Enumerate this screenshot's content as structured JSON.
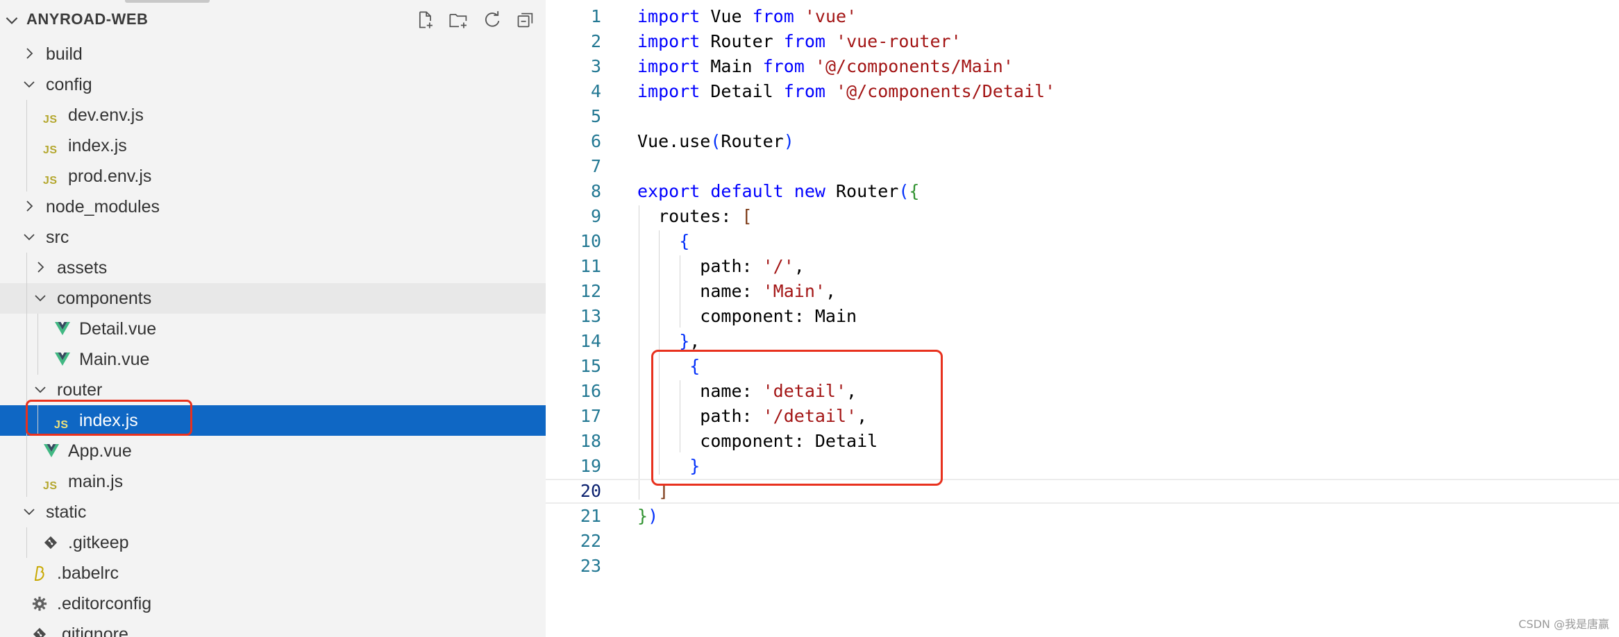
{
  "explorer": {
    "title": "ANYROAD-WEB",
    "actions": [
      {
        "name": "new-file-icon"
      },
      {
        "name": "new-folder-icon"
      },
      {
        "name": "refresh-icon"
      },
      {
        "name": "collapse-all-icon"
      }
    ],
    "items": [
      {
        "label": "build",
        "type": "folder",
        "expanded": false,
        "depth": 0
      },
      {
        "label": "config",
        "type": "folder",
        "expanded": true,
        "depth": 0
      },
      {
        "label": "dev.env.js",
        "type": "js",
        "depth": 1
      },
      {
        "label": "index.js",
        "type": "js",
        "depth": 1
      },
      {
        "label": "prod.env.js",
        "type": "js",
        "depth": 1
      },
      {
        "label": "node_modules",
        "type": "folder",
        "expanded": false,
        "depth": 0
      },
      {
        "label": "src",
        "type": "folder",
        "expanded": true,
        "depth": 0
      },
      {
        "label": "assets",
        "type": "folder",
        "expanded": false,
        "depth": 1
      },
      {
        "label": "components",
        "type": "folder",
        "expanded": true,
        "depth": 1,
        "hover": true
      },
      {
        "label": "Detail.vue",
        "type": "vue",
        "depth": 2
      },
      {
        "label": "Main.vue",
        "type": "vue",
        "depth": 2
      },
      {
        "label": "router",
        "type": "folder",
        "expanded": true,
        "depth": 1
      },
      {
        "label": "index.js",
        "type": "js",
        "depth": 2,
        "selected": true
      },
      {
        "label": "App.vue",
        "type": "vue",
        "depth": 1
      },
      {
        "label": "main.js",
        "type": "js",
        "depth": 1
      },
      {
        "label": "static",
        "type": "folder",
        "expanded": true,
        "depth": 0
      },
      {
        "label": ".gitkeep",
        "type": "git",
        "depth": 1
      },
      {
        "label": ".babelrc",
        "type": "babel",
        "depth": 0
      },
      {
        "label": ".editorconfig",
        "type": "gear",
        "depth": 0
      },
      {
        "label": ".gitignore",
        "type": "git",
        "depth": 0
      }
    ]
  },
  "editor": {
    "current_line": 20,
    "lines": [
      {
        "n": "1",
        "tokens": [
          [
            "kw",
            "import"
          ],
          [
            "t",
            " Vue "
          ],
          [
            "kw",
            "from"
          ],
          [
            "t",
            " "
          ],
          [
            "str",
            "'vue'"
          ]
        ]
      },
      {
        "n": "2",
        "tokens": [
          [
            "kw",
            "import"
          ],
          [
            "t",
            " Router "
          ],
          [
            "kw",
            "from"
          ],
          [
            "t",
            " "
          ],
          [
            "str",
            "'vue-router'"
          ]
        ]
      },
      {
        "n": "3",
        "tokens": [
          [
            "kw",
            "import"
          ],
          [
            "t",
            " Main "
          ],
          [
            "kw",
            "from"
          ],
          [
            "t",
            " "
          ],
          [
            "str",
            "'@/components/Main'"
          ]
        ]
      },
      {
        "n": "4",
        "tokens": [
          [
            "kw",
            "import"
          ],
          [
            "t",
            " Detail "
          ],
          [
            "kw",
            "from"
          ],
          [
            "t",
            " "
          ],
          [
            "str",
            "'@/components/Detail'"
          ]
        ]
      },
      {
        "n": "5",
        "tokens": []
      },
      {
        "n": "6",
        "tokens": [
          [
            "t",
            "Vue.use"
          ],
          [
            "b1",
            "("
          ],
          [
            "t",
            "Router"
          ],
          [
            "b1",
            ")"
          ]
        ]
      },
      {
        "n": "7",
        "tokens": []
      },
      {
        "n": "8",
        "tokens": [
          [
            "kw",
            "export"
          ],
          [
            "t",
            " "
          ],
          [
            "kw",
            "default"
          ],
          [
            "t",
            " "
          ],
          [
            "kw",
            "new"
          ],
          [
            "t",
            " Router"
          ],
          [
            "b1",
            "("
          ],
          [
            "b2",
            "{"
          ]
        ]
      },
      {
        "n": "9",
        "tokens": [
          [
            "t",
            "  routes: "
          ],
          [
            "b3",
            "["
          ]
        ]
      },
      {
        "n": "10",
        "tokens": [
          [
            "t",
            "    "
          ],
          [
            "b1",
            "{"
          ]
        ]
      },
      {
        "n": "11",
        "tokens": [
          [
            "t",
            "      path: "
          ],
          [
            "str",
            "'/'"
          ],
          [
            "t",
            ","
          ]
        ]
      },
      {
        "n": "12",
        "tokens": [
          [
            "t",
            "      name: "
          ],
          [
            "str",
            "'Main'"
          ],
          [
            "t",
            ","
          ]
        ]
      },
      {
        "n": "13",
        "tokens": [
          [
            "t",
            "      component: Main"
          ]
        ]
      },
      {
        "n": "14",
        "tokens": [
          [
            "t",
            "    "
          ],
          [
            "b1",
            "}"
          ],
          [
            "t",
            ","
          ]
        ]
      },
      {
        "n": "15",
        "tokens": [
          [
            "t",
            "     "
          ],
          [
            "b1",
            "{"
          ]
        ]
      },
      {
        "n": "16",
        "tokens": [
          [
            "t",
            "      name: "
          ],
          [
            "str",
            "'detail'"
          ],
          [
            "t",
            ","
          ]
        ]
      },
      {
        "n": "17",
        "tokens": [
          [
            "t",
            "      path: "
          ],
          [
            "str",
            "'/detail'"
          ],
          [
            "t",
            ","
          ]
        ]
      },
      {
        "n": "18",
        "tokens": [
          [
            "t",
            "      component: Detail"
          ]
        ]
      },
      {
        "n": "19",
        "tokens": [
          [
            "t",
            "     "
          ],
          [
            "b1",
            "}"
          ]
        ]
      },
      {
        "n": "20",
        "tokens": [
          [
            "t",
            "  "
          ],
          [
            "b3",
            "]"
          ]
        ]
      },
      {
        "n": "21",
        "tokens": [
          [
            "b2",
            "}"
          ],
          [
            "b1",
            ")"
          ]
        ]
      },
      {
        "n": "22",
        "tokens": []
      },
      {
        "n": "23",
        "tokens": []
      }
    ]
  },
  "watermark": "CSDN @我是唐赢",
  "colors": {
    "selection": "#0f67c4",
    "highlight_box": "#e8311e",
    "keyword": "#0000ff",
    "string": "#a31515"
  }
}
